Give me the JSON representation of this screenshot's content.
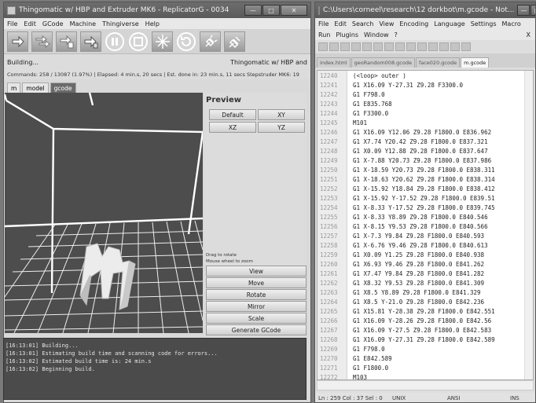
{
  "rg": {
    "title": "Thingomatic w/ HBP and Extruder MK6 - ReplicatorG - 0034",
    "menu": [
      "File",
      "Edit",
      "GCode",
      "Machine",
      "Thingiverse",
      "Help"
    ],
    "status_text": "Building...",
    "machine_name": "Thingomatic w/ HBP and",
    "progress_line": "Commands:    258 /  13087 (1.97%) | Elapsed: 4 min.s, 20 secs  |  Est. done in:  23 min.s, 11 secs  Stepstruder MK6: 19",
    "tabs": [
      "m",
      "model",
      "gcode"
    ],
    "preview_title": "Preview",
    "view_buttons": [
      "Default",
      "XY",
      "XZ",
      "YZ"
    ],
    "hint_line1": "Drag to rotate",
    "hint_line2": "Mouse wheel to zoom",
    "side_buttons": [
      "View",
      "Move",
      "Rotate",
      "Mirror",
      "Scale",
      "Generate GCode"
    ],
    "console": [
      "[16:13:01] Building...",
      "[16:13:01] Estimating build time and scanning code for errors...",
      "[16:13:02] Estimated build time is: 24 min.s",
      "[16:13:02] Beginning build."
    ]
  },
  "np": {
    "title": "C:\\Users\\corneel\\research\\12 dorkbot\\m.gcode - Not...",
    "menu1": [
      "File",
      "Edit",
      "Search",
      "View",
      "Encoding",
      "Language",
      "Settings",
      "Macro"
    ],
    "menu2": [
      "Run",
      "Plugins",
      "Window",
      "?"
    ],
    "close_x": "X",
    "tabs": [
      "index.html",
      "geoRandom008.gcode",
      "face020.gcode",
      "m.gcode"
    ],
    "lines": [
      {
        "no": "12240",
        "code": "(<loop> outer )"
      },
      {
        "no": "12241",
        "code": "G1 X16.09 Y-27.31 Z9.28 F3300.0"
      },
      {
        "no": "12242",
        "code": "G1 F798.0"
      },
      {
        "no": "12243",
        "code": "G1 E835.768"
      },
      {
        "no": "12244",
        "code": "G1 F3300.0"
      },
      {
        "no": "12245",
        "code": "M101"
      },
      {
        "no": "12246",
        "code": "G1 X16.09 Y12.06 Z9.28 F1800.0 E836.962"
      },
      {
        "no": "12247",
        "code": "G1 X7.74 Y20.42 Z9.28 F1800.0 E837.321"
      },
      {
        "no": "12248",
        "code": "G1 X0.09 Y12.88 Z9.28 F1800.0 E837.647"
      },
      {
        "no": "12249",
        "code": "G1 X-7.88 Y20.73 Z9.28 F1800.0 E837.986"
      },
      {
        "no": "12250",
        "code": "G1 X-18.59 Y20.73 Z9.28 F1800.0 E838.311"
      },
      {
        "no": "12251",
        "code": "G1 X-18.63 Y20.62 Z9.28 F1800.0 E838.314"
      },
      {
        "no": "12252",
        "code": "G1 X-15.92 Y18.84 Z9.28 F1800.0 E838.412"
      },
      {
        "no": "12253",
        "code": "G1 X-15.92 Y-17.52 Z9.28 F1800.0 E839.51"
      },
      {
        "no": "12254",
        "code": "G1 X-8.33 Y-17.52 Z9.28 F1800.0 E839.745"
      },
      {
        "no": "12255",
        "code": "G1 X-8.33 Y8.89 Z9.28 F1800.0 E840.546"
      },
      {
        "no": "12256",
        "code": "G1 X-8.15 Y9.53 Z9.28 F1800.0 E840.566"
      },
      {
        "no": "12257",
        "code": "G1 X-7.3 Y9.84 Z9.28 F1800.0 E840.593"
      },
      {
        "no": "12258",
        "code": "G1 X-6.76 Y9.46 Z9.28 F1800.0 E840.613"
      },
      {
        "no": "12259",
        "code": "G1 X0.09 Y1.25 Z9.28 F1800.0 E840.938"
      },
      {
        "no": "12260",
        "code": "G1 X6.93 Y9.46 Z9.28 F1800.0 E841.262"
      },
      {
        "no": "12261",
        "code": "G1 X7.47 Y9.84 Z9.28 F1800.0 E841.282"
      },
      {
        "no": "12262",
        "code": "G1 X8.32 Y9.53 Z9.28 F1800.0 E841.309"
      },
      {
        "no": "12263",
        "code": "G1 X8.5 Y8.89 Z9.28 F1800.0 E841.329"
      },
      {
        "no": "12264",
        "code": "G1 X8.5 Y-21.0 Z9.28 F1800.0 E842.236"
      },
      {
        "no": "12265",
        "code": "G1 X15.81 Y-28.38 Z9.28 F1800.0 E842.551"
      },
      {
        "no": "12266",
        "code": "G1 X16.09 Y-28.26 Z9.28 F1800.0 E842.56"
      },
      {
        "no": "12267",
        "code": "G1 X16.09 Y-27.5 Z9.28 F1800.0 E842.583"
      },
      {
        "no": "12268",
        "code": "G1 X16.09 Y-27.31 Z9.28 F1800.0 E842.589"
      },
      {
        "no": "12269",
        "code": "G1 F798.0"
      },
      {
        "no": "12270",
        "code": "G1 E842.589"
      },
      {
        "no": "12271",
        "code": "G1 F1800.0"
      },
      {
        "no": "12272",
        "code": "M103"
      }
    ],
    "status": {
      "pos": "Ln : 259   Col : 37   Sel : 0",
      "eol": "UNIX",
      "enc": "ANSI",
      "mode": "INS"
    }
  }
}
